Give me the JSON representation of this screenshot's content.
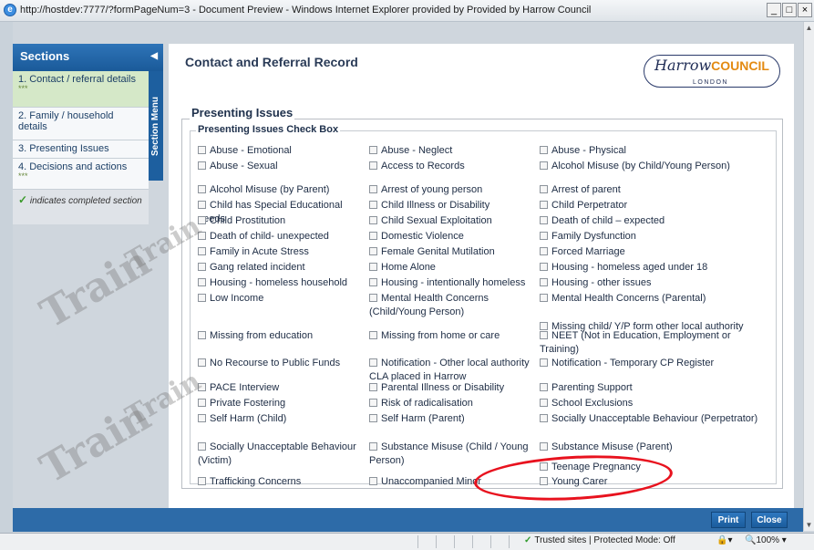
{
  "window": {
    "title": "http://hostdev:7777/?formPageNum=3 - Document Preview - Windows Internet Explorer provided by Provided by Harrow Council",
    "buttons": [
      "_",
      "□",
      "×"
    ]
  },
  "sidebar": {
    "heading": "Sections",
    "collapse_icon": "triangle-left",
    "menu_tab": "Section Menu",
    "items": [
      {
        "label": "1. Contact / referral details",
        "stars": "***"
      },
      {
        "label": "2. Family / household details",
        "stars": ""
      },
      {
        "label": "3. Presenting Issues",
        "stars": ""
      },
      {
        "label": "4. Decisions and actions",
        "stars": "***"
      }
    ],
    "note": "indicates completed section"
  },
  "page": {
    "title": "Contact and Referral Record",
    "logo": {
      "brand": "Harrow",
      "council": "COUNCIL",
      "sub": "LONDON"
    },
    "section_legend": "Presenting Issues",
    "group_legend": "Presenting Issues Check Box",
    "checkboxes": [
      "Abuse - Emotional",
      "Abuse - Neglect",
      "Abuse - Physical",
      "Abuse - Sexual",
      "Access to Records",
      "Alcohol Misuse (by Child/Young Person)",
      "Alcohol Misuse (by Parent)",
      "Arrest of young person",
      "Arrest of parent",
      "Child has Special Educational needs",
      "Child Illness or Disability",
      "Child Perpetrator",
      "Child Prostitution",
      "Child Sexual Exploitation",
      "Death of child – expected",
      "Death of child- unexpected",
      "Domestic Violence",
      "Family Dysfunction",
      "Family in Acute Stress",
      "Female Genital Mutilation",
      "Forced Marriage",
      "Gang related incident",
      "Home Alone",
      "Housing - homeless aged under 18",
      "Housing - homeless household",
      "Housing - intentionally homeless",
      "Housing - other issues",
      "Low Income",
      "Mental Health Concerns (Child/Young Person)",
      "Mental Health Concerns (Parental)",
      "Missing child/ Y/P form other local authority",
      "Missing from education",
      "Missing from home or care",
      "NEET (Not in Education, Employment or Training)",
      "No Recourse to Public Funds",
      "Notification - Other local authority CLA placed in Harrow",
      "Notification - Temporary CP Register",
      "PACE Interview",
      "Parental Illness or Disability",
      "Parenting Support",
      "Private Fostering",
      "Risk of radicalisation",
      "School Exclusions",
      "Self Harm (Child)",
      "Self Harm (Parent)",
      "Socially Unacceptable Behaviour (Perpetrator)",
      "Socially Unacceptable Behaviour (Victim)",
      "Substance Misuse (Child / Young Person)",
      "Substance Misuse (Parent)",
      "Teenage Pregnancy",
      "Trafficking Concerns",
      "Unaccompanied Minor",
      "Young Carer"
    ]
  },
  "footer": {
    "print_label": "Print",
    "close_label": "Close"
  },
  "status": {
    "zone": "Trusted sites | Protected Mode: Off",
    "zoom": "100%"
  },
  "watermark": "Train",
  "colors": {
    "accent": "#1d5f9f",
    "highlight": "#e8121e",
    "done": "#3a9a2a"
  }
}
